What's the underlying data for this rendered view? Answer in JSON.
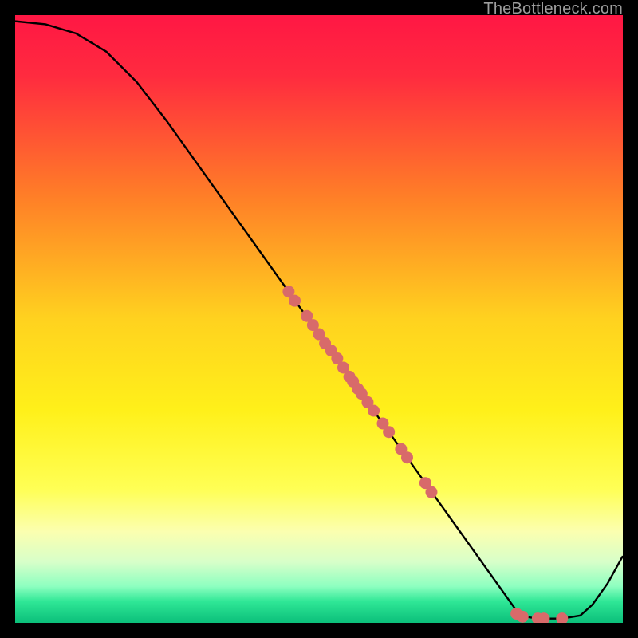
{
  "watermark": "TheBottleneck.com",
  "chart_data": {
    "type": "line",
    "title": "",
    "xlabel": "",
    "ylabel": "",
    "xlim": [
      0,
      100
    ],
    "ylim": [
      0,
      100
    ],
    "background_gradient": {
      "stops": [
        {
          "pos": 0.0,
          "color": "#ff1744"
        },
        {
          "pos": 0.1,
          "color": "#ff2b3f"
        },
        {
          "pos": 0.3,
          "color": "#ff7f27"
        },
        {
          "pos": 0.5,
          "color": "#ffd21f"
        },
        {
          "pos": 0.65,
          "color": "#fff01a"
        },
        {
          "pos": 0.78,
          "color": "#ffff55"
        },
        {
          "pos": 0.85,
          "color": "#fbffb0"
        },
        {
          "pos": 0.9,
          "color": "#d7ffc9"
        },
        {
          "pos": 0.94,
          "color": "#8dffc0"
        },
        {
          "pos": 0.965,
          "color": "#2fe796"
        },
        {
          "pos": 1.0,
          "color": "#0bbf7a"
        }
      ]
    },
    "series": [
      {
        "name": "curve",
        "type": "line",
        "color": "#000000",
        "points": [
          {
            "x": 0.0,
            "y": 99.0
          },
          {
            "x": 5.0,
            "y": 98.5
          },
          {
            "x": 10.0,
            "y": 97.0
          },
          {
            "x": 15.0,
            "y": 94.0
          },
          {
            "x": 20.0,
            "y": 89.0
          },
          {
            "x": 25.0,
            "y": 82.5
          },
          {
            "x": 30.0,
            "y": 75.5
          },
          {
            "x": 35.0,
            "y": 68.5
          },
          {
            "x": 40.0,
            "y": 61.5
          },
          {
            "x": 45.0,
            "y": 54.5
          },
          {
            "x": 50.0,
            "y": 47.5
          },
          {
            "x": 55.0,
            "y": 40.5
          },
          {
            "x": 60.0,
            "y": 33.5
          },
          {
            "x": 65.0,
            "y": 26.5
          },
          {
            "x": 70.0,
            "y": 19.5
          },
          {
            "x": 75.0,
            "y": 12.5
          },
          {
            "x": 80.0,
            "y": 5.5
          },
          {
            "x": 82.5,
            "y": 2.0
          },
          {
            "x": 84.0,
            "y": 1.0
          },
          {
            "x": 86.0,
            "y": 0.7
          },
          {
            "x": 90.0,
            "y": 0.7
          },
          {
            "x": 93.0,
            "y": 1.2
          },
          {
            "x": 95.0,
            "y": 3.0
          },
          {
            "x": 97.5,
            "y": 6.5
          },
          {
            "x": 100.0,
            "y": 11.0
          }
        ]
      },
      {
        "name": "markers",
        "type": "scatter",
        "color": "#d86a6a",
        "points": [
          {
            "x": 45.0,
            "y": 54.5
          },
          {
            "x": 46.0,
            "y": 53.0
          },
          {
            "x": 48.0,
            "y": 50.5
          },
          {
            "x": 49.0,
            "y": 49.0
          },
          {
            "x": 50.0,
            "y": 47.5
          },
          {
            "x": 51.0,
            "y": 46.0
          },
          {
            "x": 52.0,
            "y": 44.8
          },
          {
            "x": 53.0,
            "y": 43.5
          },
          {
            "x": 54.0,
            "y": 42.0
          },
          {
            "x": 55.0,
            "y": 40.5
          },
          {
            "x": 55.6,
            "y": 39.7
          },
          {
            "x": 56.4,
            "y": 38.5
          },
          {
            "x": 57.0,
            "y": 37.7
          },
          {
            "x": 58.0,
            "y": 36.3
          },
          {
            "x": 59.0,
            "y": 34.9
          },
          {
            "x": 60.5,
            "y": 32.8
          },
          {
            "x": 61.5,
            "y": 31.4
          },
          {
            "x": 63.5,
            "y": 28.6
          },
          {
            "x": 64.5,
            "y": 27.2
          },
          {
            "x": 67.5,
            "y": 23.0
          },
          {
            "x": 68.5,
            "y": 21.5
          },
          {
            "x": 82.5,
            "y": 1.5
          },
          {
            "x": 83.5,
            "y": 1.0
          },
          {
            "x": 86.0,
            "y": 0.7
          },
          {
            "x": 87.0,
            "y": 0.7
          },
          {
            "x": 90.0,
            "y": 0.7
          }
        ]
      }
    ]
  }
}
